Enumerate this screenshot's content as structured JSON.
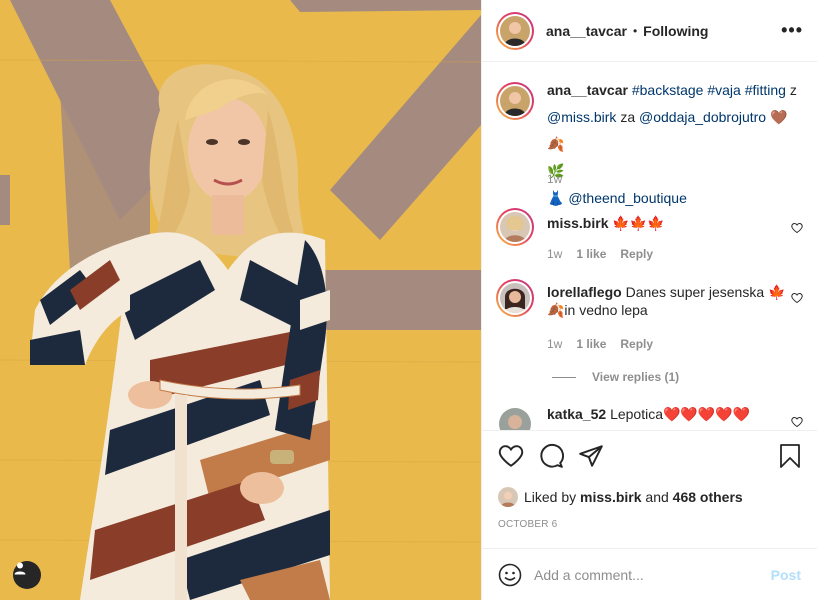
{
  "post": {
    "author": "ana__tavcar",
    "follow_status": "Following",
    "more_label": "•••",
    "caption": {
      "username": "ana__tavcar",
      "hashtags": [
        "#backstage",
        "#vaja",
        "#fitting"
      ],
      "text_z": "z",
      "mention1": "@miss.birk",
      "text_za": "za",
      "mention2": "@oddaja_dobrojutro",
      "emojis1": "🤎🍂",
      "emojis2": "🌿",
      "dress_emoji": "👗",
      "mention3": "@theend_boutique",
      "time": "1w"
    },
    "comments": [
      {
        "username": "miss.birk",
        "text": "🍁🍁🍁",
        "time": "1w",
        "likes": "1 like",
        "reply": "Reply"
      },
      {
        "username": "lorellaflego",
        "text": "Danes super jesenska 🍁",
        "text2": "🍂in vedno lepa",
        "time": "1w",
        "likes": "1 like",
        "reply": "Reply",
        "view_replies": "View replies (1)"
      },
      {
        "username": "katka_52",
        "text": "Lepotica❤️❤️❤️❤️❤️"
      }
    ],
    "liked_by": {
      "prefix": "Liked by",
      "user": "miss.birk",
      "and": "and",
      "others": "468 others"
    },
    "date": "OCTOBER 6",
    "add_comment_placeholder": "Add a comment...",
    "post_button": "Post"
  },
  "colors": {
    "wall": "#e8b84a",
    "link": "#00376b",
    "muted": "#8e8e8e",
    "post_disabled": "#b2dffc"
  },
  "icons": {
    "like": "heart-icon",
    "comment": "comment-bubble-icon",
    "share": "paper-plane-icon",
    "save": "bookmark-icon",
    "emoji": "smiley-icon",
    "user_tag": "user-tag-icon"
  }
}
